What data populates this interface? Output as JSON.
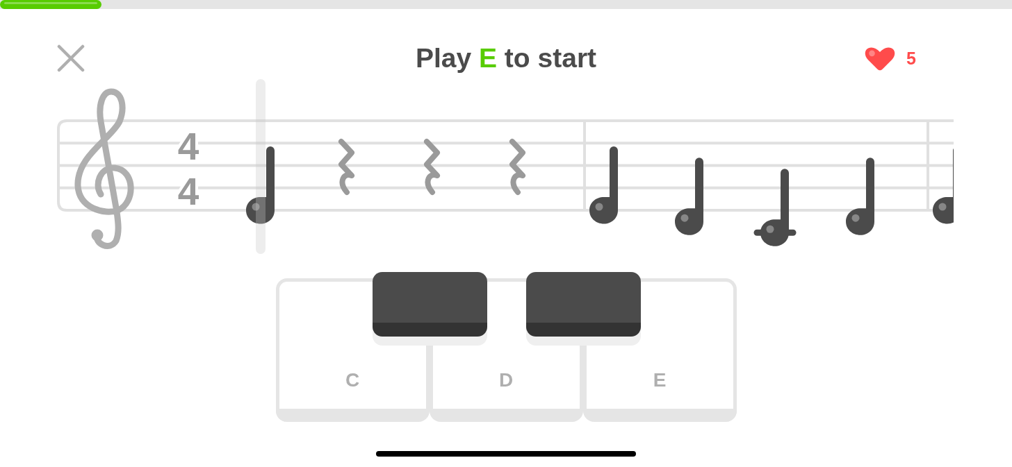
{
  "progress": {
    "level": 0.1
  },
  "header": {
    "title": [
      {
        "text": "Play ",
        "highlight": false
      },
      {
        "text": "E",
        "highlight": true
      },
      {
        "text": " to start",
        "highlight": false
      }
    ],
    "lives": "5"
  },
  "staff": {
    "time_signature": {
      "numerator": "4",
      "denominator": "4"
    },
    "measures": [
      {
        "items": [
          {
            "kind": "e4",
            "selected": true
          },
          {
            "kind": "rest",
            "selected": false
          },
          {
            "kind": "rest",
            "selected": false
          },
          {
            "kind": "rest",
            "selected": false
          }
        ]
      },
      {
        "items": [
          {
            "kind": "e4",
            "selected": false
          },
          {
            "kind": "d4",
            "selected": false
          },
          {
            "kind": "c4",
            "selected": false
          },
          {
            "kind": "d4",
            "selected": false
          }
        ]
      },
      {
        "items": [
          {
            "kind": "e4",
            "selected": false
          }
        ]
      }
    ]
  },
  "keyboard": {
    "keys": [
      {
        "kind": "white",
        "label": "C"
      },
      {
        "kind": "black"
      },
      {
        "kind": "white",
        "label": "D"
      },
      {
        "kind": "black"
      },
      {
        "kind": "white",
        "label": "E"
      }
    ]
  }
}
